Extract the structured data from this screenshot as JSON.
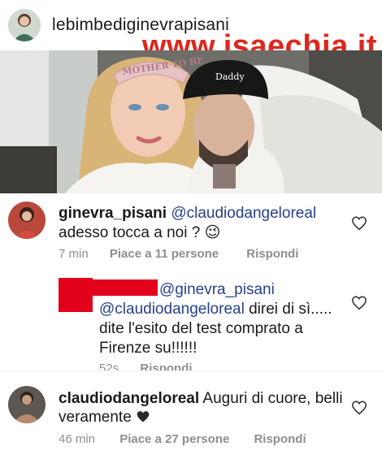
{
  "post": {
    "username": "lebimbediginevrapisani",
    "watermark": "www.isaechia.it",
    "photo_text": {
      "tiara": "MOTHER TO BE",
      "cap": "Daddy"
    }
  },
  "comments": [
    {
      "username": "ginevra_pisani",
      "mention": "@claudiodangeloreal",
      "text": "adesso tocca a noi ?",
      "emoji": "😉",
      "time": "7 min",
      "likes": "Piace a 11 persone",
      "reply": "Rispondi"
    },
    {
      "mention1": "@ginevra_pisani",
      "mention2": "@claudiodangeloreal",
      "line1_rest": "direi di sì.....",
      "line2": "dite l'esito del test comprato a",
      "line3": "Firenze su!!!!!!",
      "time": "52s",
      "reply": "Rispondi"
    },
    {
      "username": "claudiodangeloreal",
      "text1": "Auguri di cuore, belli",
      "text2": "veramente",
      "time": "46 min",
      "likes": "Piace a 27 persone",
      "reply": "Rispondi"
    }
  ],
  "colors": {
    "mention": "#27408b",
    "watermark": "#e0261b",
    "redaction": "#e3001b",
    "meta": "#8e8e8e"
  },
  "icons": [
    "heart-outline-icon",
    "black-heart-emoji-icon",
    "winking-face-emoji-icon"
  ]
}
